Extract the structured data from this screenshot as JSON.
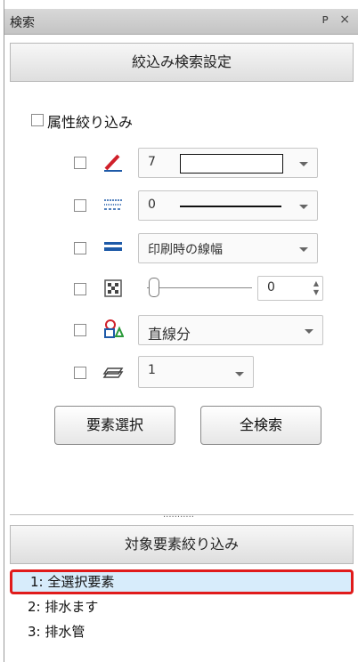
{
  "window": {
    "title": "検索",
    "pin_glyph": "ᴘ",
    "close_glyph": "×"
  },
  "filter_settings": {
    "header": "絞込み検索設定",
    "attribute_filter_label": "属性絞り込み",
    "rows": {
      "color": {
        "icon": "pen-color-icon",
        "value": "7"
      },
      "linetype": {
        "icon": "line-type-icon",
        "value": "0"
      },
      "linewidth": {
        "icon": "line-width-icon",
        "value": "印刷時の線幅"
      },
      "transparency": {
        "icon": "transparency-icon",
        "value": "0"
      },
      "element_type": {
        "icon": "shape-type-icon",
        "value": "直線分"
      },
      "layer": {
        "icon": "layer-icon",
        "value": "1"
      }
    },
    "select_elements_button": "要素選択",
    "search_all_button": "全検索"
  },
  "target_filter": {
    "header": "対象要素絞り込み",
    "items": [
      {
        "label": "1: 全選択要素",
        "selected": true
      },
      {
        "label": "2: 排水ます",
        "selected": false
      },
      {
        "label": "3: 排水管",
        "selected": false
      }
    ]
  },
  "colors": {
    "highlight_border": "#e01b1b",
    "selected_bg": "#d7ecfb",
    "pen_red": "#d0202a",
    "accent_blue": "#1e5aa8"
  }
}
